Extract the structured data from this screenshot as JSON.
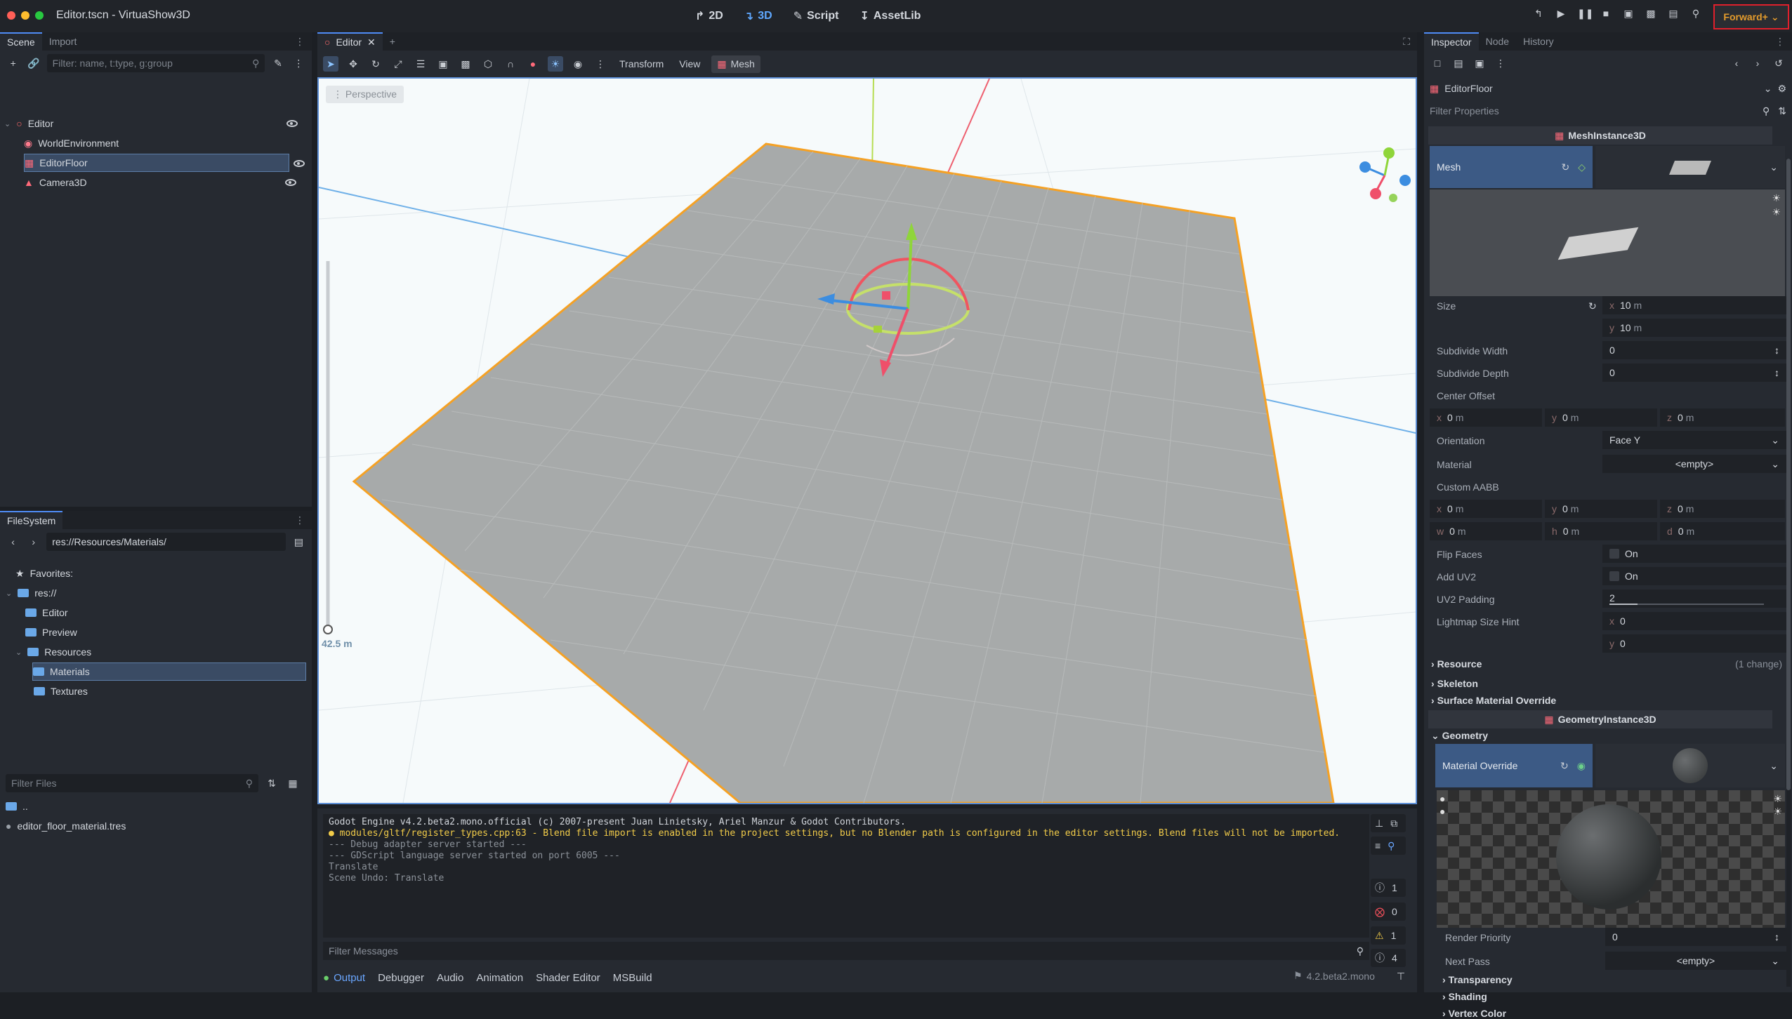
{
  "window": {
    "title": "Editor.tscn - VirtuaShow3D"
  },
  "main_modes": [
    {
      "label": "2D",
      "icon": "2d-icon"
    },
    {
      "label": "3D",
      "icon": "3d-icon"
    },
    {
      "label": "Script",
      "icon": "script-icon"
    },
    {
      "label": "AssetLib",
      "icon": "assetlib-icon"
    }
  ],
  "renderer": {
    "label": "Forward+"
  },
  "scene_dock": {
    "tabs": [
      "Scene",
      "Import"
    ],
    "filter_placeholder": "Filter: name, t:type, g:group",
    "nodes": [
      {
        "label": "Editor"
      },
      {
        "label": "WorldEnvironment"
      },
      {
        "label": "EditorFloor"
      },
      {
        "label": "Camera3D"
      }
    ]
  },
  "filesystem": {
    "tab": "FileSystem",
    "path": "res://Resources/Materials/",
    "tree": [
      {
        "label": "Favorites:"
      },
      {
        "label": "res://"
      },
      {
        "label": "Editor"
      },
      {
        "label": "Preview"
      },
      {
        "label": "Resources"
      },
      {
        "label": "Materials"
      },
      {
        "label": "Textures"
      }
    ],
    "filter_placeholder": "Filter Files",
    "files": [
      {
        "label": ".."
      },
      {
        "label": "editor_floor_material.tres"
      }
    ]
  },
  "center": {
    "tab_label": "Editor",
    "toolbar_menus": [
      "Transform",
      "View",
      "Mesh"
    ],
    "perspective_label": "Perspective",
    "zoom_label": "42.5 m"
  },
  "output": {
    "log": [
      {
        "text": "Godot Engine v4.2.beta2.mono.official (c) 2007-present Juan Linietsky, Ariel Manzur & Godot Contributors.",
        "kind": "info"
      },
      {
        "text": "● modules/gltf/register_types.cpp:63 - Blend file import is enabled in the project settings, but no Blender path is configured in the editor settings. Blend files will not be imported.",
        "kind": "warn"
      },
      {
        "text": "--- Debug adapter server started ---",
        "kind": "dim"
      },
      {
        "text": "--- GDScript language server started on port 6005 ---",
        "kind": "dim"
      },
      {
        "text": "Translate",
        "kind": "dim"
      },
      {
        "text": "Scene Undo: Translate",
        "kind": "dim"
      }
    ],
    "filter_placeholder": "Filter Messages",
    "counters": [
      "1",
      "0",
      "1",
      "4"
    ],
    "bottom_tabs": [
      "Output",
      "Debugger",
      "Audio",
      "Animation",
      "Shader Editor",
      "MSBuild"
    ],
    "version": "4.2.beta2.mono"
  },
  "inspector": {
    "tabs": [
      "Inspector",
      "Node",
      "History"
    ],
    "object_name": "EditorFloor",
    "filter_placeholder": "Filter Properties",
    "mesh_section": "MeshInstance3D",
    "mesh_label": "Mesh",
    "size_label": "Size",
    "size_x": "10",
    "size_y": "10",
    "unit_m": "m",
    "subdivide_width_label": "Subdivide Width",
    "subdivide_width": "0",
    "subdivide_depth_label": "Subdivide Depth",
    "subdivide_depth": "0",
    "center_offset_label": "Center Offset",
    "center_offset": [
      "0",
      "0",
      "0"
    ],
    "orientation_label": "Orientation",
    "orientation": "Face Y",
    "material_label": "Material",
    "material": "<empty>",
    "custom_aabb_label": "Custom AABB",
    "aabb": [
      "0",
      "0",
      "0",
      "0",
      "0",
      "0"
    ],
    "flip_faces_label": "Flip Faces",
    "add_uv2_label": "Add UV2",
    "on_label": "On",
    "uv2_padding_label": "UV2 Padding",
    "uv2_padding": "2",
    "lightmap_label": "Lightmap Size Hint",
    "lightmap": [
      "0",
      "0"
    ],
    "resource_label": "Resource",
    "resource_changes": "(1 change)",
    "skeleton_label": "Skeleton",
    "surface_override_label": "Surface Material Override",
    "geometry_section": "GeometryInstance3D",
    "geometry_label": "Geometry",
    "material_override_label": "Material Override",
    "render_priority_label": "Render Priority",
    "render_priority": "0",
    "next_pass_label": "Next Pass",
    "next_pass": "<empty>",
    "transparency_label": "Transparency",
    "shading_label": "Shading",
    "vertex_color_label": "Vertex Color"
  },
  "colors": {
    "accent": "#4f8cf6",
    "selection": "#3a4b64",
    "warning": "#f2cc49",
    "error": "#e0202c",
    "renderer_text": "#e39b2c"
  }
}
